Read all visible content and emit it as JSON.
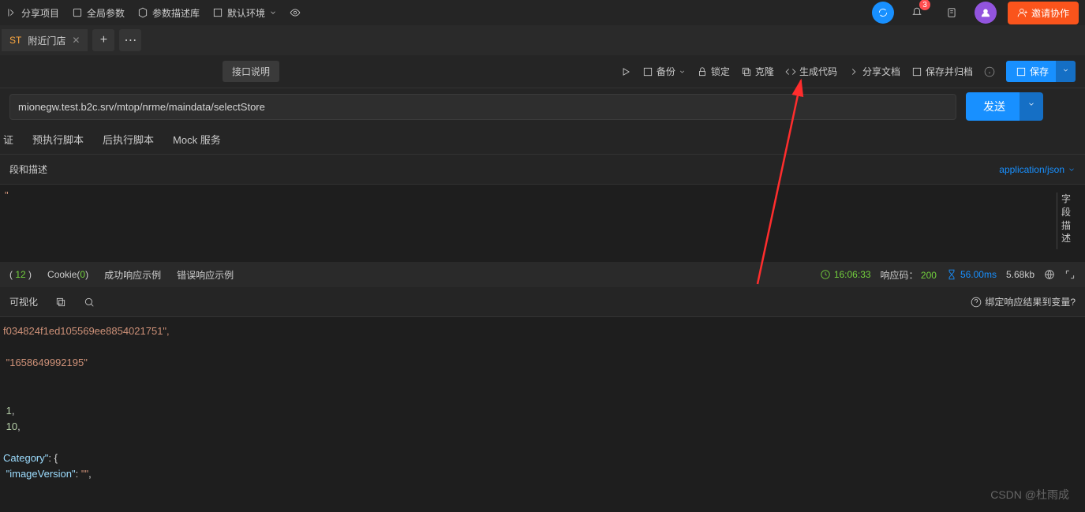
{
  "topbar": {
    "share": "分享项目",
    "global": "全局参数",
    "params": "参数描述库",
    "env": "默认环境",
    "invite": "邀请协作",
    "badge": "3"
  },
  "tab": {
    "method": "ST",
    "name": "附近门店"
  },
  "actions": {
    "desc": "接口说明",
    "backup": "备份",
    "lock": "锁定",
    "clone": "克隆",
    "gencode": "生成代码",
    "sharedoc": "分享文档",
    "archive": "保存并归档",
    "save": "保存"
  },
  "url": {
    "value": "mionegw.test.b2c.srv/mtop/nrme/maindata/selectStore",
    "send": "发送"
  },
  "reqtabs": {
    "auth": "证",
    "prescript": "预执行脚本",
    "postscript": "后执行脚本",
    "mock": "Mock 服务"
  },
  "subbar": {
    "left": "段和描述",
    "contenttype": "application/json"
  },
  "sidelabel": [
    "字",
    "段",
    "描",
    "述"
  ],
  "editor": {
    "snippet": "\""
  },
  "resulttabs": {
    "header_count": "12",
    "cookie": "Cookie(",
    "cookie_count": "0",
    "cookie_close": ")",
    "success": "成功响应示例",
    "error": "错误响应示例"
  },
  "resultmeta": {
    "time": "16:06:33",
    "status_label": "响应码：",
    "status_code": "200",
    "duration": "56.00ms",
    "size": "5.68kb"
  },
  "viewbar": {
    "visual": "可视化",
    "bind": "绑定响应结果到变量?"
  },
  "response": {
    "lines": [
      {
        "t": "str",
        "v": "f034824f1ed105569ee8854021751\","
      },
      {
        "t": "blank",
        "v": ""
      },
      {
        "t": "str",
        "v": " \"1658649992195\""
      },
      {
        "t": "blank",
        "v": ""
      },
      {
        "t": "blank",
        "v": ""
      },
      {
        "t": "mixed",
        "parts": [
          {
            "c": "num",
            "v": " 1"
          },
          {
            "c": "punc",
            "v": ","
          }
        ]
      },
      {
        "t": "mixed",
        "parts": [
          {
            "c": "num",
            "v": " 10"
          },
          {
            "c": "punc",
            "v": ","
          }
        ]
      },
      {
        "t": "blank",
        "v": ""
      },
      {
        "t": "mixed",
        "parts": [
          {
            "c": "key",
            "v": "Category\""
          },
          {
            "c": "punc",
            "v": ": {"
          }
        ]
      },
      {
        "t": "mixed",
        "parts": [
          {
            "c": "key",
            "v": " \"imageVersion\""
          },
          {
            "c": "punc",
            "v": ": "
          },
          {
            "c": "str",
            "v": "\"\""
          },
          {
            "c": "punc",
            "v": ","
          }
        ]
      }
    ]
  },
  "watermark": "CSDN @杜雨成"
}
